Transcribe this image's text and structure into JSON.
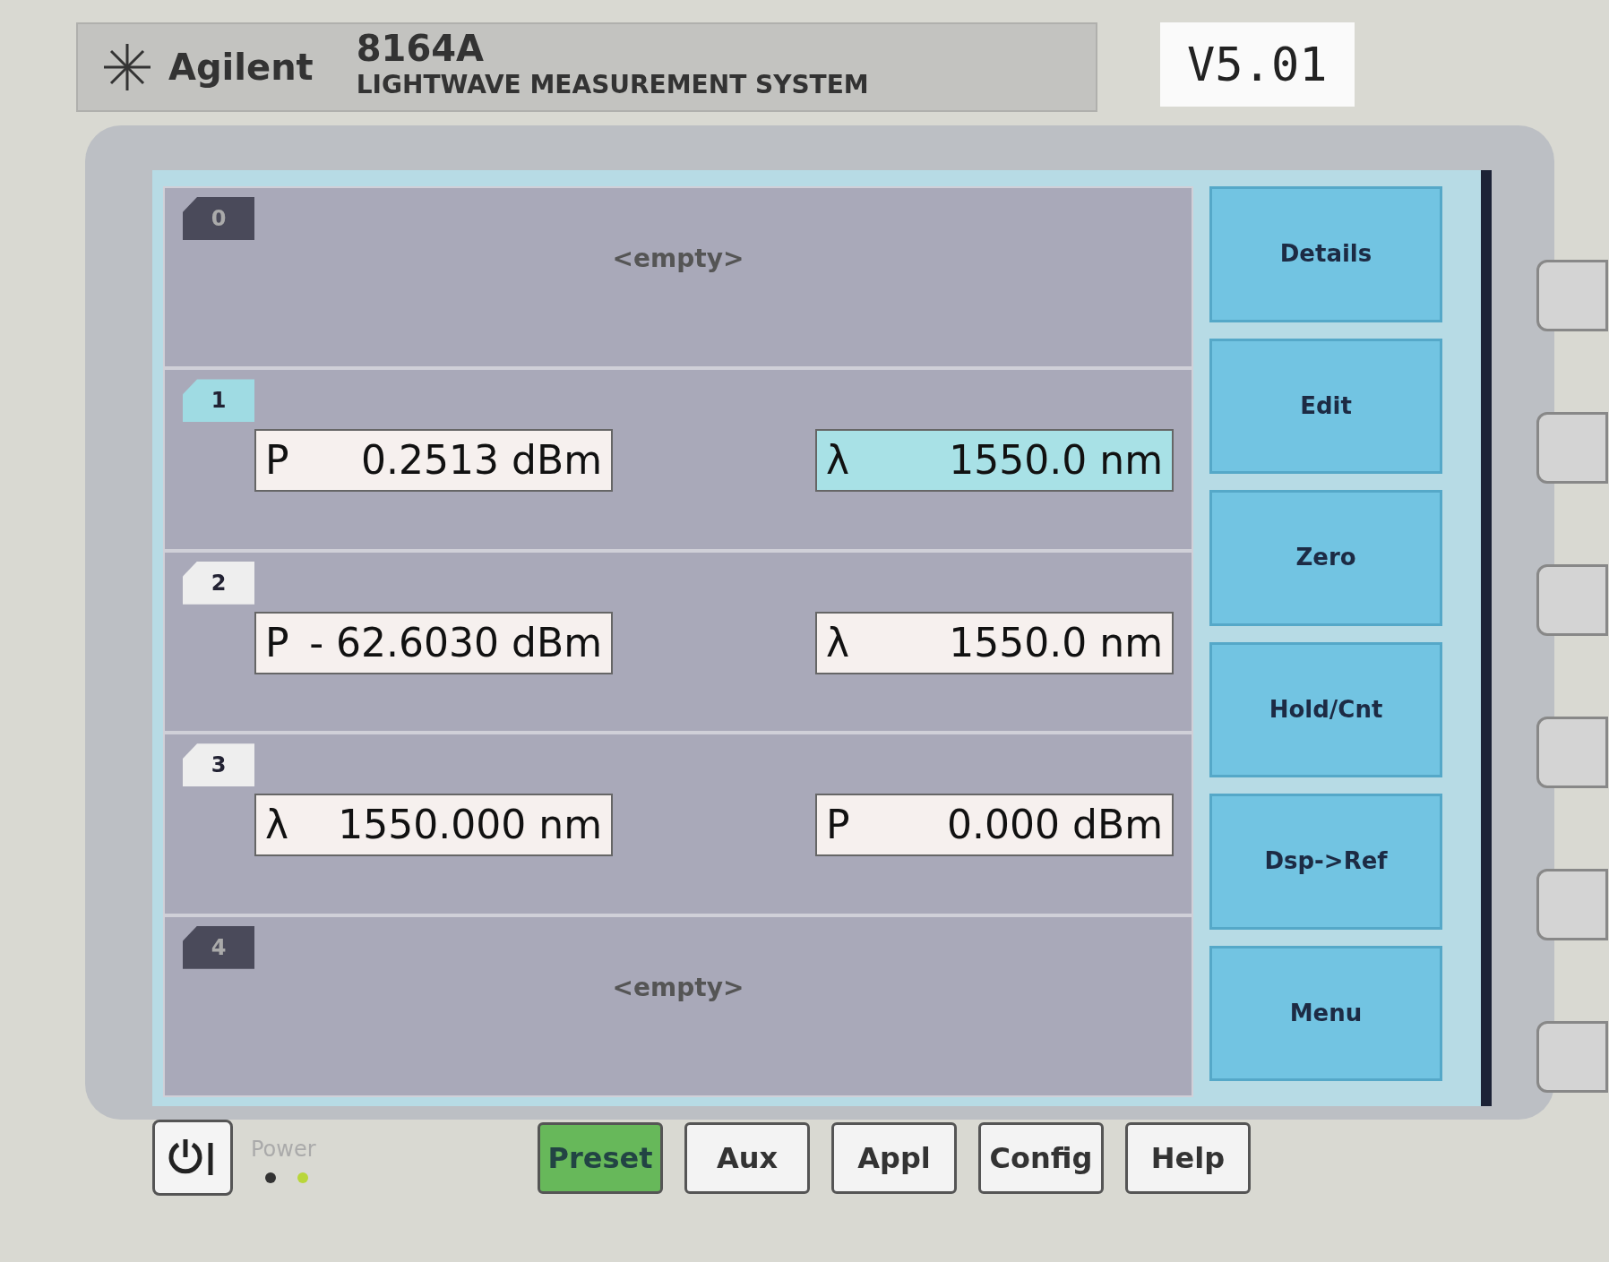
{
  "header": {
    "brand": "Agilent",
    "model": "8164A",
    "subtitle": "LIGHTWAVE MEASUREMENT SYSTEM",
    "version": "V5.01"
  },
  "slots": [
    {
      "number": "0",
      "kind": "empty",
      "text": "<empty>"
    },
    {
      "number": "1",
      "kind": "module",
      "selected": true,
      "fields": [
        {
          "symbol": "P",
          "value": "0.2513 dBm",
          "selected": false
        },
        {
          "symbol": "λ",
          "value": "1550.0 nm",
          "selected": true
        }
      ]
    },
    {
      "number": "2",
      "kind": "module",
      "selected": false,
      "fields": [
        {
          "symbol": "P",
          "value": "- 62.6030 dBm",
          "selected": false
        },
        {
          "symbol": "λ",
          "value": "1550.0 nm",
          "selected": false
        }
      ]
    },
    {
      "number": "3",
      "kind": "module",
      "selected": false,
      "fields": [
        {
          "symbol": "λ",
          "value": "1550.000 nm",
          "selected": false
        },
        {
          "symbol": "P",
          "value": "0.000 dBm",
          "selected": false
        }
      ]
    },
    {
      "number": "4",
      "kind": "empty",
      "text": "<empty>"
    }
  ],
  "softkeys": [
    "Details",
    "Edit",
    "Zero",
    "Hold/Cnt",
    "Dsp->Ref",
    "Menu"
  ],
  "power": {
    "label": "Power",
    "leds": [
      {
        "on": false
      },
      {
        "on": true
      }
    ]
  },
  "panel_keys": [
    {
      "label": "Preset",
      "kind": "green"
    },
    {
      "label": "Aux",
      "kind": "plain"
    },
    {
      "label": "Appl",
      "kind": "plain"
    },
    {
      "label": "Config",
      "kind": "plain"
    },
    {
      "label": "Help",
      "kind": "plain"
    }
  ]
}
